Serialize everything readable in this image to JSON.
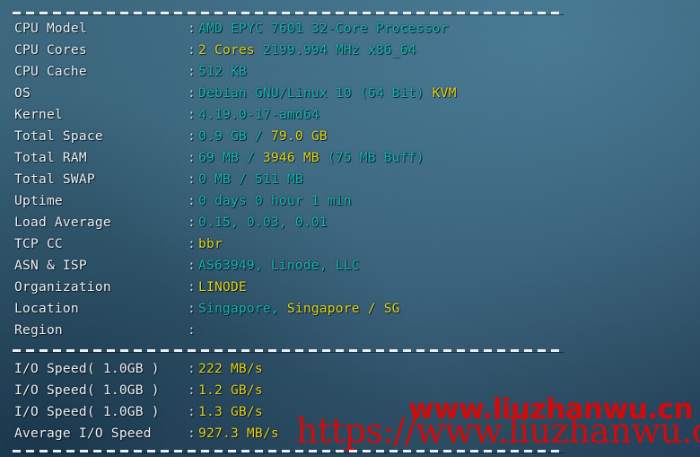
{
  "terminal": {
    "separator_glyph": "----------------------------------------------------------------------",
    "colon": ":"
  },
  "system_info": {
    "rows": [
      {
        "label": "CPU Model",
        "segments": [
          {
            "text": "AMD EPYC 7601 32-Core Processor",
            "color": "cyan"
          }
        ]
      },
      {
        "label": "CPU Cores",
        "segments": [
          {
            "text": "2 Cores",
            "color": "yellow"
          },
          {
            "text": " 2199.994 MHz x86_64",
            "color": "cyan"
          }
        ]
      },
      {
        "label": "CPU Cache",
        "segments": [
          {
            "text": "512 KB",
            "color": "cyan"
          }
        ]
      },
      {
        "label": "OS",
        "segments": [
          {
            "text": "Debian GNU/Linux 10 (64 Bit) ",
            "color": "cyan"
          },
          {
            "text": "KVM",
            "color": "yellow"
          }
        ]
      },
      {
        "label": "Kernel",
        "segments": [
          {
            "text": "4.19.0-17-amd64",
            "color": "cyan"
          }
        ]
      },
      {
        "label": "Total Space",
        "segments": [
          {
            "text": "0.9 GB / ",
            "color": "cyan"
          },
          {
            "text": "79.0 GB",
            "color": "yellow"
          }
        ]
      },
      {
        "label": "Total RAM",
        "segments": [
          {
            "text": "69 MB / ",
            "color": "cyan"
          },
          {
            "text": "3946 MB",
            "color": "yellow"
          },
          {
            "text": " (75 MB Buff)",
            "color": "cyan"
          }
        ]
      },
      {
        "label": "Total SWAP",
        "segments": [
          {
            "text": "0 MB / 511 MB",
            "color": "cyan"
          }
        ]
      },
      {
        "label": "Uptime",
        "segments": [
          {
            "text": "0 days 0 hour 1 min",
            "color": "cyan"
          }
        ]
      },
      {
        "label": "Load Average",
        "segments": [
          {
            "text": "0.15, 0.03, 0.01",
            "color": "cyan"
          }
        ]
      },
      {
        "label": "TCP CC",
        "segments": [
          {
            "text": "bbr",
            "color": "yellow"
          }
        ]
      },
      {
        "label": "ASN & ISP",
        "segments": [
          {
            "text": "AS63949, Linode, LLC",
            "color": "cyan"
          }
        ]
      },
      {
        "label": "Organization",
        "segments": [
          {
            "text": "LINODE",
            "color": "yellow"
          }
        ]
      },
      {
        "label": "Location",
        "segments": [
          {
            "text": "Singapore, ",
            "color": "cyan"
          },
          {
            "text": "Singapore / SG",
            "color": "yellow"
          }
        ]
      },
      {
        "label": "Region",
        "segments": []
      }
    ]
  },
  "io_benchmark": {
    "rows": [
      {
        "label": "I/O Speed( 1.0GB )",
        "segments": [
          {
            "text": "222 MB/s",
            "color": "yellow"
          }
        ]
      },
      {
        "label": "I/O Speed( 1.0GB )",
        "segments": [
          {
            "text": "1.2 GB/s",
            "color": "yellow"
          }
        ]
      },
      {
        "label": "I/O Speed( 1.0GB )",
        "segments": [
          {
            "text": "1.3 GB/s",
            "color": "yellow"
          }
        ]
      },
      {
        "label": "Average I/O Speed",
        "segments": [
          {
            "text": "927.3 MB/s",
            "color": "yellow"
          }
        ]
      }
    ]
  },
  "watermarks": {
    "cn": "www.liuzhanwu.cn",
    "com": "https://www.liuzhanwu.com"
  },
  "colors": {
    "cyan": "#16b4ae",
    "yellow": "#e3d217",
    "label": "#eef2f4",
    "watermark_red": "#d30a0a",
    "background": "#37607a"
  }
}
